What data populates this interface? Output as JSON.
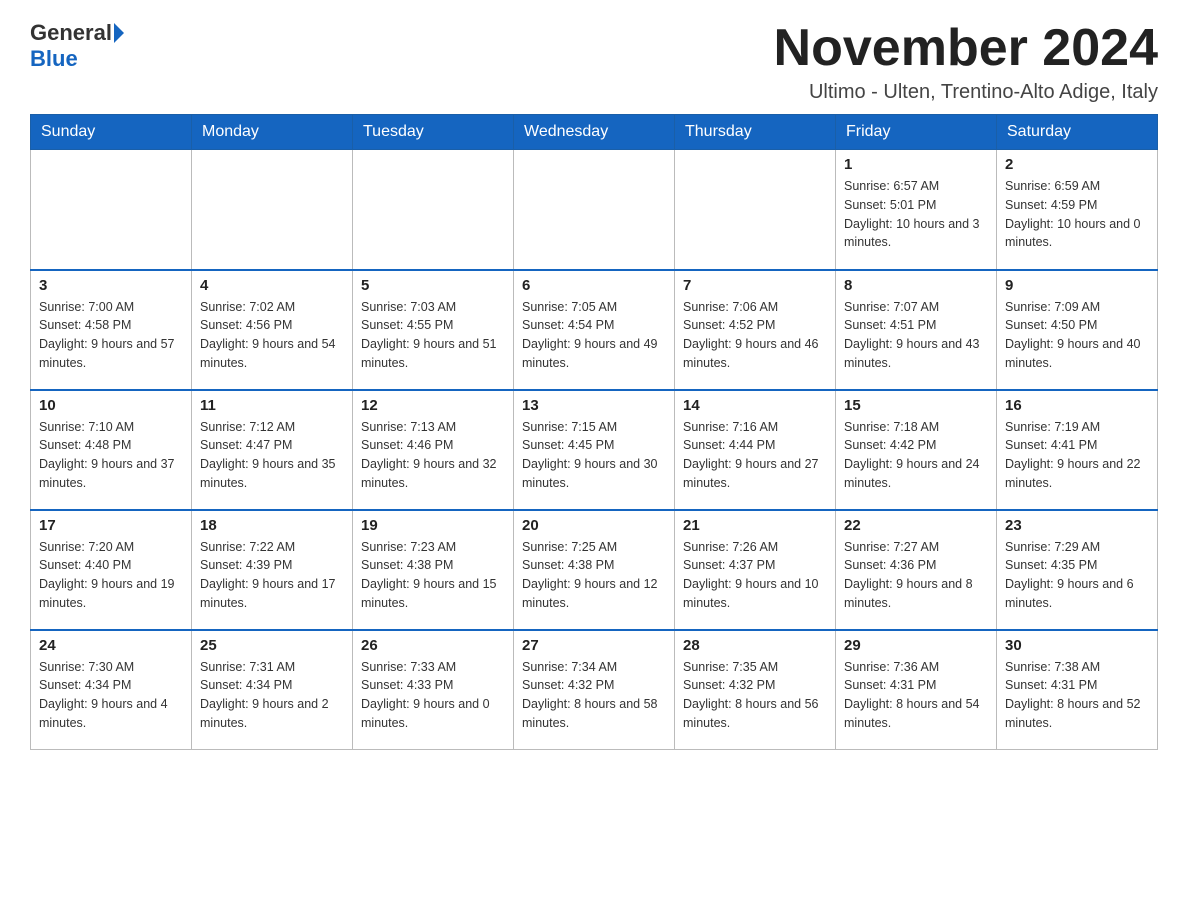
{
  "logo": {
    "general": "General",
    "blue": "Blue"
  },
  "title": "November 2024",
  "subtitle": "Ultimo - Ulten, Trentino-Alto Adige, Italy",
  "days_of_week": [
    "Sunday",
    "Monday",
    "Tuesday",
    "Wednesday",
    "Thursday",
    "Friday",
    "Saturday"
  ],
  "weeks": [
    [
      {
        "day": "",
        "info": ""
      },
      {
        "day": "",
        "info": ""
      },
      {
        "day": "",
        "info": ""
      },
      {
        "day": "",
        "info": ""
      },
      {
        "day": "",
        "info": ""
      },
      {
        "day": "1",
        "info": "Sunrise: 6:57 AM\nSunset: 5:01 PM\nDaylight: 10 hours and 3 minutes."
      },
      {
        "day": "2",
        "info": "Sunrise: 6:59 AM\nSunset: 4:59 PM\nDaylight: 10 hours and 0 minutes."
      }
    ],
    [
      {
        "day": "3",
        "info": "Sunrise: 7:00 AM\nSunset: 4:58 PM\nDaylight: 9 hours and 57 minutes."
      },
      {
        "day": "4",
        "info": "Sunrise: 7:02 AM\nSunset: 4:56 PM\nDaylight: 9 hours and 54 minutes."
      },
      {
        "day": "5",
        "info": "Sunrise: 7:03 AM\nSunset: 4:55 PM\nDaylight: 9 hours and 51 minutes."
      },
      {
        "day": "6",
        "info": "Sunrise: 7:05 AM\nSunset: 4:54 PM\nDaylight: 9 hours and 49 minutes."
      },
      {
        "day": "7",
        "info": "Sunrise: 7:06 AM\nSunset: 4:52 PM\nDaylight: 9 hours and 46 minutes."
      },
      {
        "day": "8",
        "info": "Sunrise: 7:07 AM\nSunset: 4:51 PM\nDaylight: 9 hours and 43 minutes."
      },
      {
        "day": "9",
        "info": "Sunrise: 7:09 AM\nSunset: 4:50 PM\nDaylight: 9 hours and 40 minutes."
      }
    ],
    [
      {
        "day": "10",
        "info": "Sunrise: 7:10 AM\nSunset: 4:48 PM\nDaylight: 9 hours and 37 minutes."
      },
      {
        "day": "11",
        "info": "Sunrise: 7:12 AM\nSunset: 4:47 PM\nDaylight: 9 hours and 35 minutes."
      },
      {
        "day": "12",
        "info": "Sunrise: 7:13 AM\nSunset: 4:46 PM\nDaylight: 9 hours and 32 minutes."
      },
      {
        "day": "13",
        "info": "Sunrise: 7:15 AM\nSunset: 4:45 PM\nDaylight: 9 hours and 30 minutes."
      },
      {
        "day": "14",
        "info": "Sunrise: 7:16 AM\nSunset: 4:44 PM\nDaylight: 9 hours and 27 minutes."
      },
      {
        "day": "15",
        "info": "Sunrise: 7:18 AM\nSunset: 4:42 PM\nDaylight: 9 hours and 24 minutes."
      },
      {
        "day": "16",
        "info": "Sunrise: 7:19 AM\nSunset: 4:41 PM\nDaylight: 9 hours and 22 minutes."
      }
    ],
    [
      {
        "day": "17",
        "info": "Sunrise: 7:20 AM\nSunset: 4:40 PM\nDaylight: 9 hours and 19 minutes."
      },
      {
        "day": "18",
        "info": "Sunrise: 7:22 AM\nSunset: 4:39 PM\nDaylight: 9 hours and 17 minutes."
      },
      {
        "day": "19",
        "info": "Sunrise: 7:23 AM\nSunset: 4:38 PM\nDaylight: 9 hours and 15 minutes."
      },
      {
        "day": "20",
        "info": "Sunrise: 7:25 AM\nSunset: 4:38 PM\nDaylight: 9 hours and 12 minutes."
      },
      {
        "day": "21",
        "info": "Sunrise: 7:26 AM\nSunset: 4:37 PM\nDaylight: 9 hours and 10 minutes."
      },
      {
        "day": "22",
        "info": "Sunrise: 7:27 AM\nSunset: 4:36 PM\nDaylight: 9 hours and 8 minutes."
      },
      {
        "day": "23",
        "info": "Sunrise: 7:29 AM\nSunset: 4:35 PM\nDaylight: 9 hours and 6 minutes."
      }
    ],
    [
      {
        "day": "24",
        "info": "Sunrise: 7:30 AM\nSunset: 4:34 PM\nDaylight: 9 hours and 4 minutes."
      },
      {
        "day": "25",
        "info": "Sunrise: 7:31 AM\nSunset: 4:34 PM\nDaylight: 9 hours and 2 minutes."
      },
      {
        "day": "26",
        "info": "Sunrise: 7:33 AM\nSunset: 4:33 PM\nDaylight: 9 hours and 0 minutes."
      },
      {
        "day": "27",
        "info": "Sunrise: 7:34 AM\nSunset: 4:32 PM\nDaylight: 8 hours and 58 minutes."
      },
      {
        "day": "28",
        "info": "Sunrise: 7:35 AM\nSunset: 4:32 PM\nDaylight: 8 hours and 56 minutes."
      },
      {
        "day": "29",
        "info": "Sunrise: 7:36 AM\nSunset: 4:31 PM\nDaylight: 8 hours and 54 minutes."
      },
      {
        "day": "30",
        "info": "Sunrise: 7:38 AM\nSunset: 4:31 PM\nDaylight: 8 hours and 52 minutes."
      }
    ]
  ]
}
